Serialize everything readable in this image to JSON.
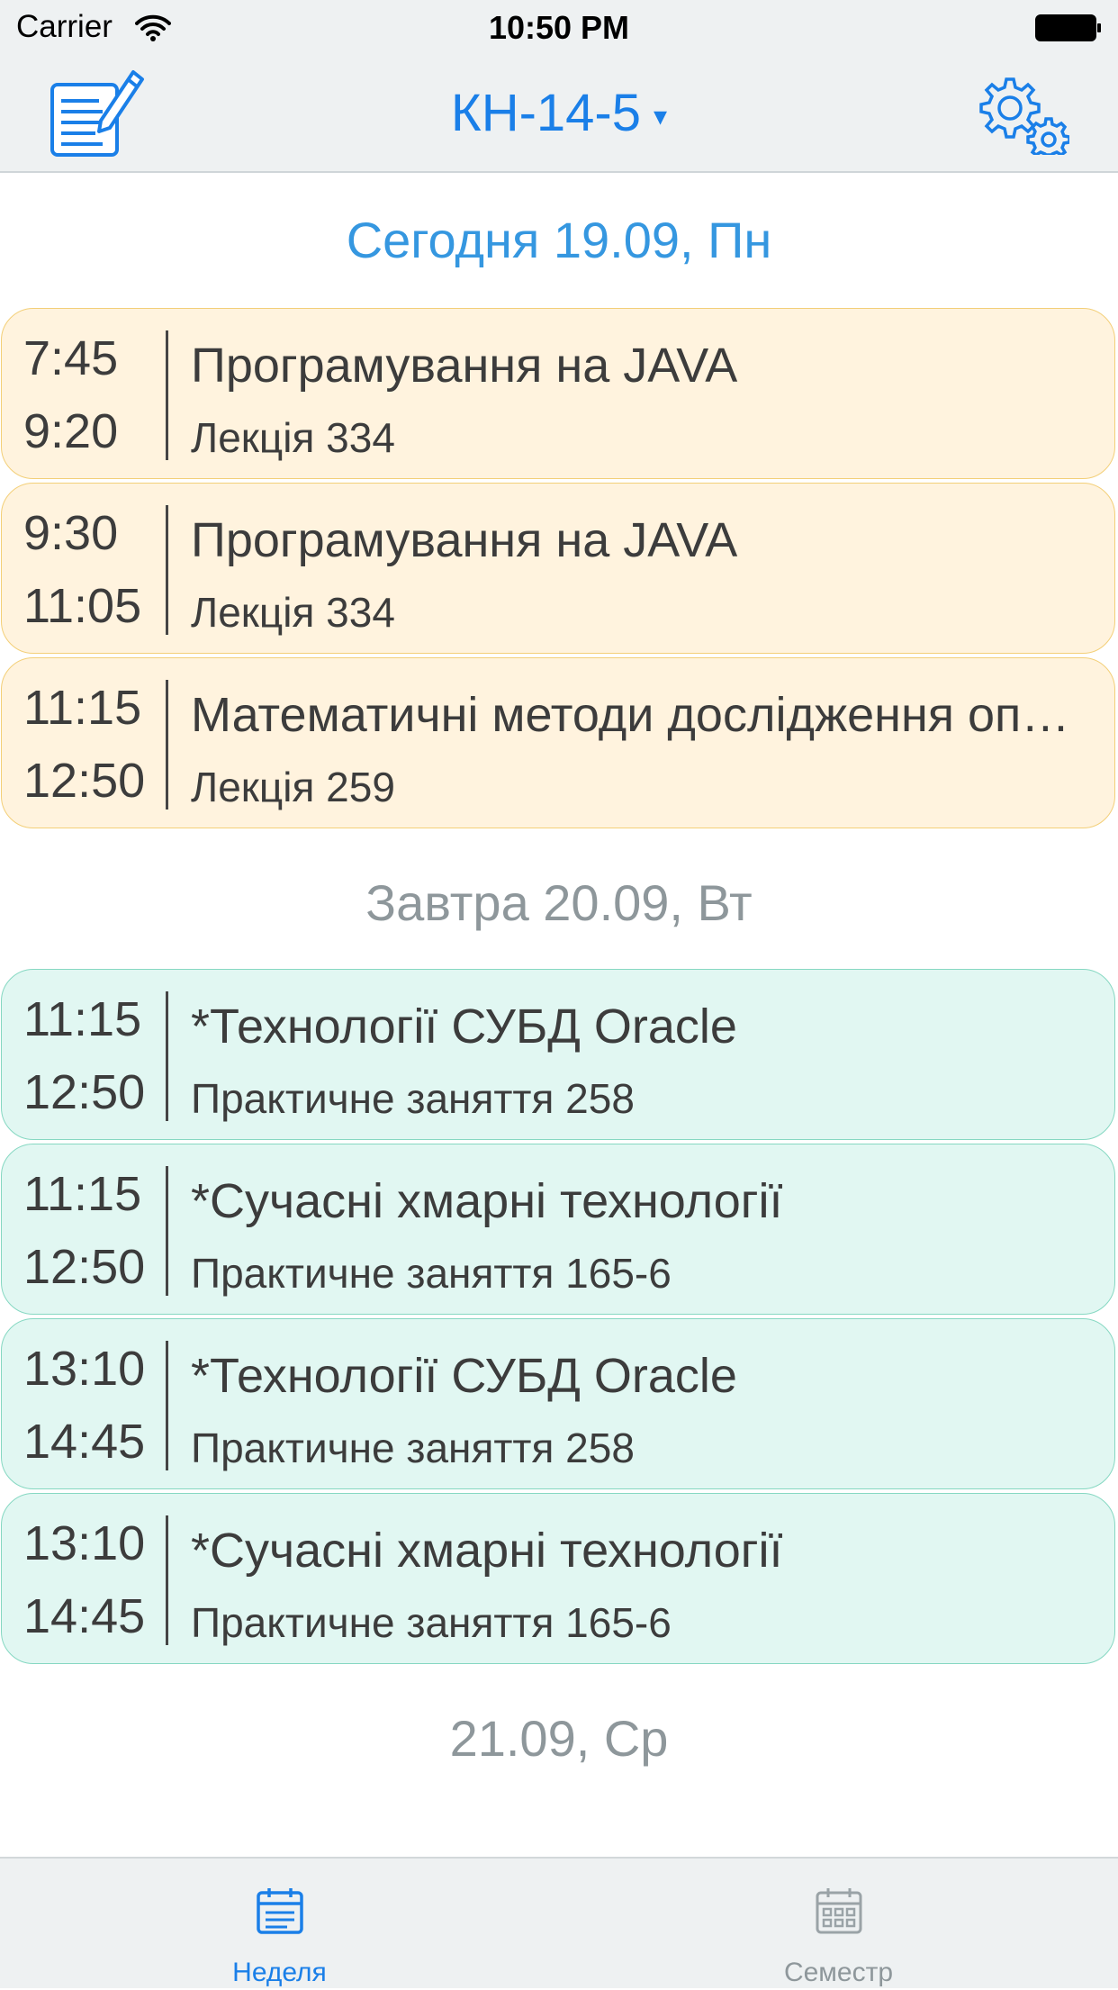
{
  "status_bar": {
    "carrier": "Carrier",
    "time": "10:50 PM"
  },
  "nav": {
    "group_title": "КН-14-5",
    "caret": "▾",
    "accent_color": "#1a7fe8",
    "left_icon": "edit-notes-icon",
    "right_icon": "settings-gears-icon"
  },
  "days": [
    {
      "header": "Сегодня 19.09, Пн",
      "lessons": [
        {
          "start": "7:45",
          "end": "9:20",
          "subject": "Програмування на JAVA",
          "room": "Лекція 334"
        },
        {
          "start": "9:30",
          "end": "11:05",
          "subject": "Програмування на JAVA",
          "room": "Лекція 334"
        },
        {
          "start": "11:15",
          "end": "12:50",
          "subject": "Математичні методи дослідження операцій",
          "room": "Лекція 259"
        }
      ]
    },
    {
      "header": "Завтра 20.09, Вт",
      "lessons": [
        {
          "start": "11:15",
          "end": "12:50",
          "subject": "*Технології СУБД Oracle",
          "room": "Практичне заняття 258"
        },
        {
          "start": "11:15",
          "end": "12:50",
          "subject": "*Сучасні хмарні технології",
          "room": "Практичне заняття 165-6"
        },
        {
          "start": "13:10",
          "end": "14:45",
          "subject": "*Технології СУБД Oracle",
          "room": "Практичне заняття 258"
        },
        {
          "start": "13:10",
          "end": "14:45",
          "subject": "*Сучасні хмарні технології",
          "room": "Практичне заняття 165-6"
        }
      ]
    },
    {
      "header": "21.09, Ср",
      "lessons": []
    }
  ],
  "colors": {
    "lecture_bg": "#fff3de",
    "lecture_border": "#f3cf78",
    "practice_bg": "#e1f7f2",
    "practice_border": "#86d8c2"
  },
  "tabs": [
    {
      "label": "Неделя",
      "icon": "calendar-week-icon",
      "active": true
    },
    {
      "label": "Семестр",
      "icon": "calendar-month-icon",
      "active": false
    }
  ]
}
